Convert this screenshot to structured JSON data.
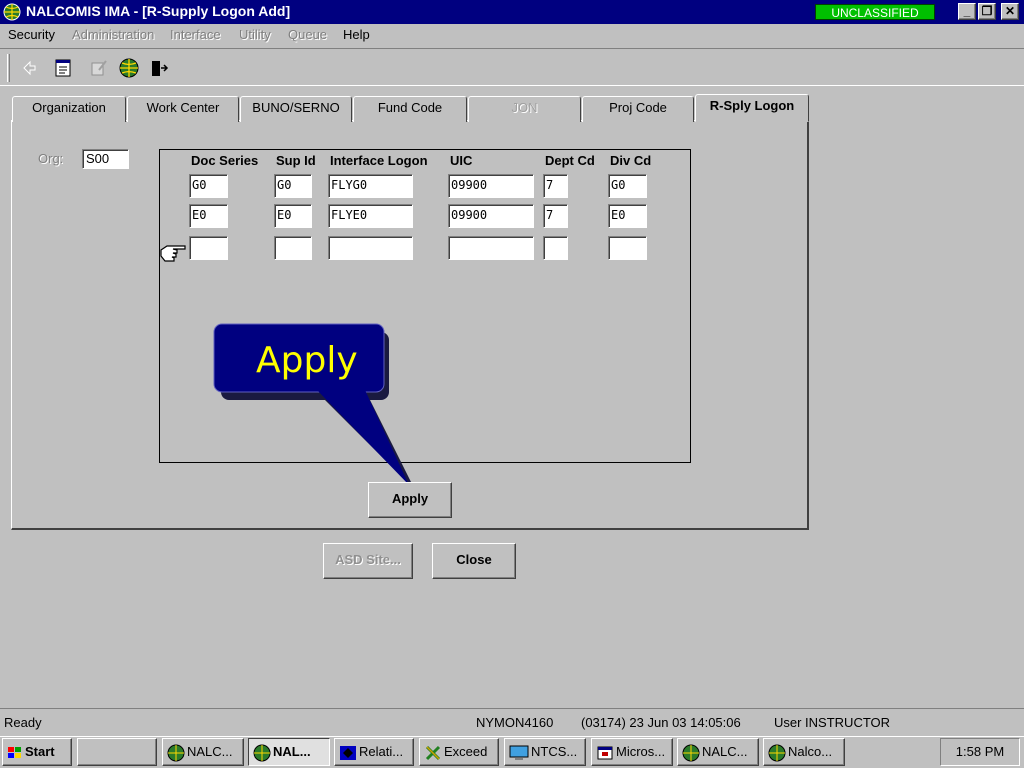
{
  "window": {
    "title": "NALCOMIS IMA - [R-Supply Logon Add]",
    "classification": "UNCLASSIFIED",
    "controls": {
      "minimize": "_",
      "restore": "❐",
      "close": "✕"
    }
  },
  "menu": {
    "items": [
      {
        "label": "Security",
        "enabled": true
      },
      {
        "label": "Administration",
        "enabled": false
      },
      {
        "label": "Interface",
        "enabled": false
      },
      {
        "label": "Utility",
        "enabled": false
      },
      {
        "label": "Queue",
        "enabled": false
      },
      {
        "label": "Help",
        "enabled": true
      }
    ]
  },
  "toolbar": {
    "icons": [
      "back-arrow-icon",
      "notes-icon",
      "edit-pencil-icon",
      "globe-icon",
      "exit-door-icon"
    ]
  },
  "tabs": [
    {
      "label": "Organization",
      "state": "normal"
    },
    {
      "label": "Work Center",
      "state": "normal"
    },
    {
      "label": "BUNO/SERNO",
      "state": "normal"
    },
    {
      "label": "Fund Code",
      "state": "normal"
    },
    {
      "label": "JON",
      "state": "disabled"
    },
    {
      "label": "Proj Code",
      "state": "normal"
    },
    {
      "label": "R-Sply Logon",
      "state": "active"
    }
  ],
  "form": {
    "org_label": "Org:",
    "org_value": "S00",
    "grid": {
      "headers": [
        "Doc Series",
        "Sup Id",
        "Interface Logon",
        "UIC",
        "Dept Cd",
        "Div Cd"
      ],
      "rows": [
        [
          "G0",
          "G0",
          "FLYG0",
          "09900",
          "7",
          "G0"
        ],
        [
          "E0",
          "E0",
          "FLYE0",
          "09900",
          "7",
          "E0"
        ],
        [
          "",
          "",
          "",
          "",
          "",
          ""
        ]
      ]
    }
  },
  "callout": {
    "text": "Apply",
    "fill": "#000080",
    "text_color": "#ffff00"
  },
  "buttons": {
    "apply": "Apply",
    "asd_site": "ASD Site...",
    "close": "Close"
  },
  "status": {
    "ready": "Ready",
    "host": "NYMON4160",
    "session": "(03174)  23 Jun 03  14:05:06",
    "user": "User INSTRUCTOR"
  },
  "taskbar": {
    "start": "Start",
    "tasks": [
      {
        "label": "",
        "icon": ""
      },
      {
        "label": "NALC...",
        "icon": "globe-icon"
      },
      {
        "label": "NAL...",
        "icon": "globe-icon",
        "active": true
      },
      {
        "label": "Relati...",
        "icon": "diamond-icon"
      },
      {
        "label": "Exceed",
        "icon": "x-icon"
      },
      {
        "label": "NTCS...",
        "icon": "monitor-icon"
      },
      {
        "label": "Micros...",
        "icon": "window-icon"
      },
      {
        "label": "NALC...",
        "icon": "globe-icon"
      },
      {
        "label": "Nalco...",
        "icon": "globe-icon"
      }
    ],
    "clock": "1:58 PM"
  }
}
